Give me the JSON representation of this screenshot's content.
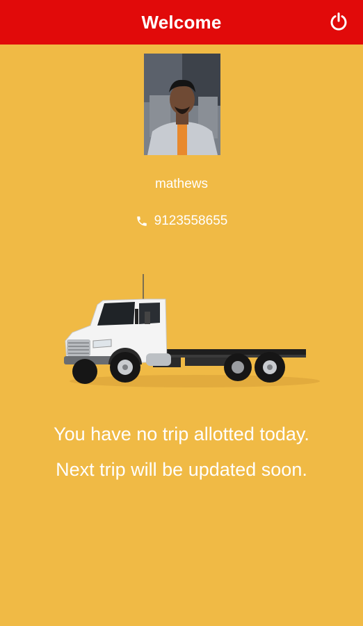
{
  "app_bar": {
    "title": "Welcome",
    "power_icon": "power-icon",
    "background_color": "#E10A0A"
  },
  "profile": {
    "avatar": "driver-photo",
    "name": "mathews",
    "phone_icon": "phone-icon",
    "phone": "9123558655"
  },
  "illustration": "truck-icon",
  "messages": {
    "no_trip": "You have no trip allotted today.",
    "next_trip": "Next trip will be updated soon."
  },
  "colors": {
    "background": "#F0BA45",
    "text": "#FFFFFF"
  }
}
